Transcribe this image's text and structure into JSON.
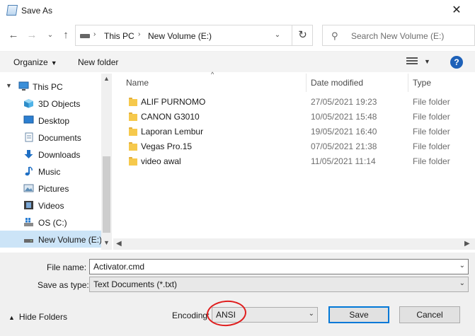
{
  "window": {
    "title": "Save As"
  },
  "nav": {
    "breadcrumb": [
      "This PC",
      "New Volume (E:)"
    ]
  },
  "search": {
    "placeholder": "Search New Volume (E:)"
  },
  "toolbar": {
    "organize": "Organize",
    "new_folder": "New folder"
  },
  "sidebar": {
    "items": [
      {
        "label": "This PC",
        "icon": "computer-icon"
      },
      {
        "label": "3D Objects",
        "icon": "cube-icon"
      },
      {
        "label": "Desktop",
        "icon": "desktop-icon"
      },
      {
        "label": "Documents",
        "icon": "documents-icon"
      },
      {
        "label": "Downloads",
        "icon": "download-icon"
      },
      {
        "label": "Music",
        "icon": "music-icon"
      },
      {
        "label": "Pictures",
        "icon": "pictures-icon"
      },
      {
        "label": "Videos",
        "icon": "videos-icon"
      },
      {
        "label": "OS (C:)",
        "icon": "os-drive-icon"
      },
      {
        "label": "New Volume (E:)",
        "icon": "drive-icon"
      }
    ]
  },
  "columns": {
    "name": "Name",
    "date": "Date modified",
    "type": "Type"
  },
  "files": [
    {
      "name": "ALIF PURNOMO",
      "date": "27/05/2021 19:23",
      "type": "File folder"
    },
    {
      "name": "CANON G3010",
      "date": "10/05/2021 15:48",
      "type": "File folder"
    },
    {
      "name": "Laporan Lembur",
      "date": "19/05/2021 16:40",
      "type": "File folder"
    },
    {
      "name": "Vegas Pro.15",
      "date": "07/05/2021 21:38",
      "type": "File folder"
    },
    {
      "name": "video awal",
      "date": "11/05/2021 11:14",
      "type": "File folder"
    }
  ],
  "form": {
    "file_name_label": "File name:",
    "file_name_value": "Activator.cmd",
    "save_type_label": "Save as type:",
    "save_type_value": "Text Documents (*.txt)",
    "encoding_label": "Encoding:",
    "encoding_value": "ANSI"
  },
  "footer": {
    "hide_folders": "Hide Folders",
    "save": "Save",
    "cancel": "Cancel"
  },
  "colors": {
    "selected": "#cce4f7",
    "accent": "#0078d7",
    "annotation": "#e01e1e",
    "folder": "#f6c94c"
  }
}
